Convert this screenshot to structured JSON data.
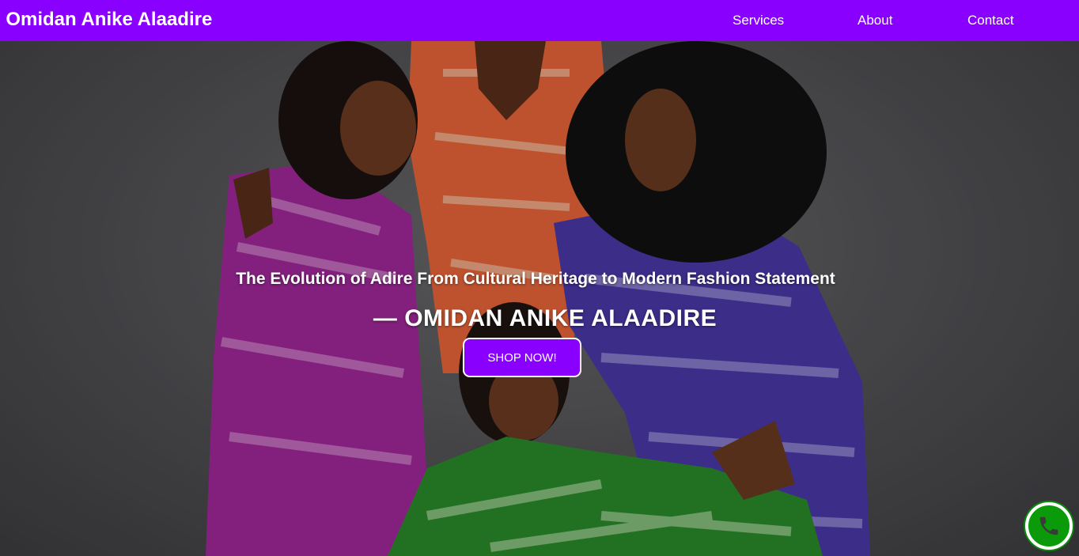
{
  "navbar": {
    "brand": ". Omidan Anike Alaadire",
    "links": [
      {
        "label": "Services"
      },
      {
        "label": "About"
      },
      {
        "label": "Contact"
      }
    ]
  },
  "hero": {
    "headline": "The Evolution of Adire From Cultural Heritage to Modern Fashion Statement",
    "author": "— OMIDAN ANIKE ALAADIRE",
    "cta_label": "SHOP NOW!"
  },
  "floating_action": {
    "icon": "phone-icon"
  },
  "colors": {
    "brand_purple": "#8a00ff",
    "call_green": "#0a9a0a",
    "dress_magenta": "#a02a9a",
    "dress_orange": "#f06a2a",
    "dress_indigo": "#4a3aa8",
    "dress_green": "#2a8a2a"
  }
}
